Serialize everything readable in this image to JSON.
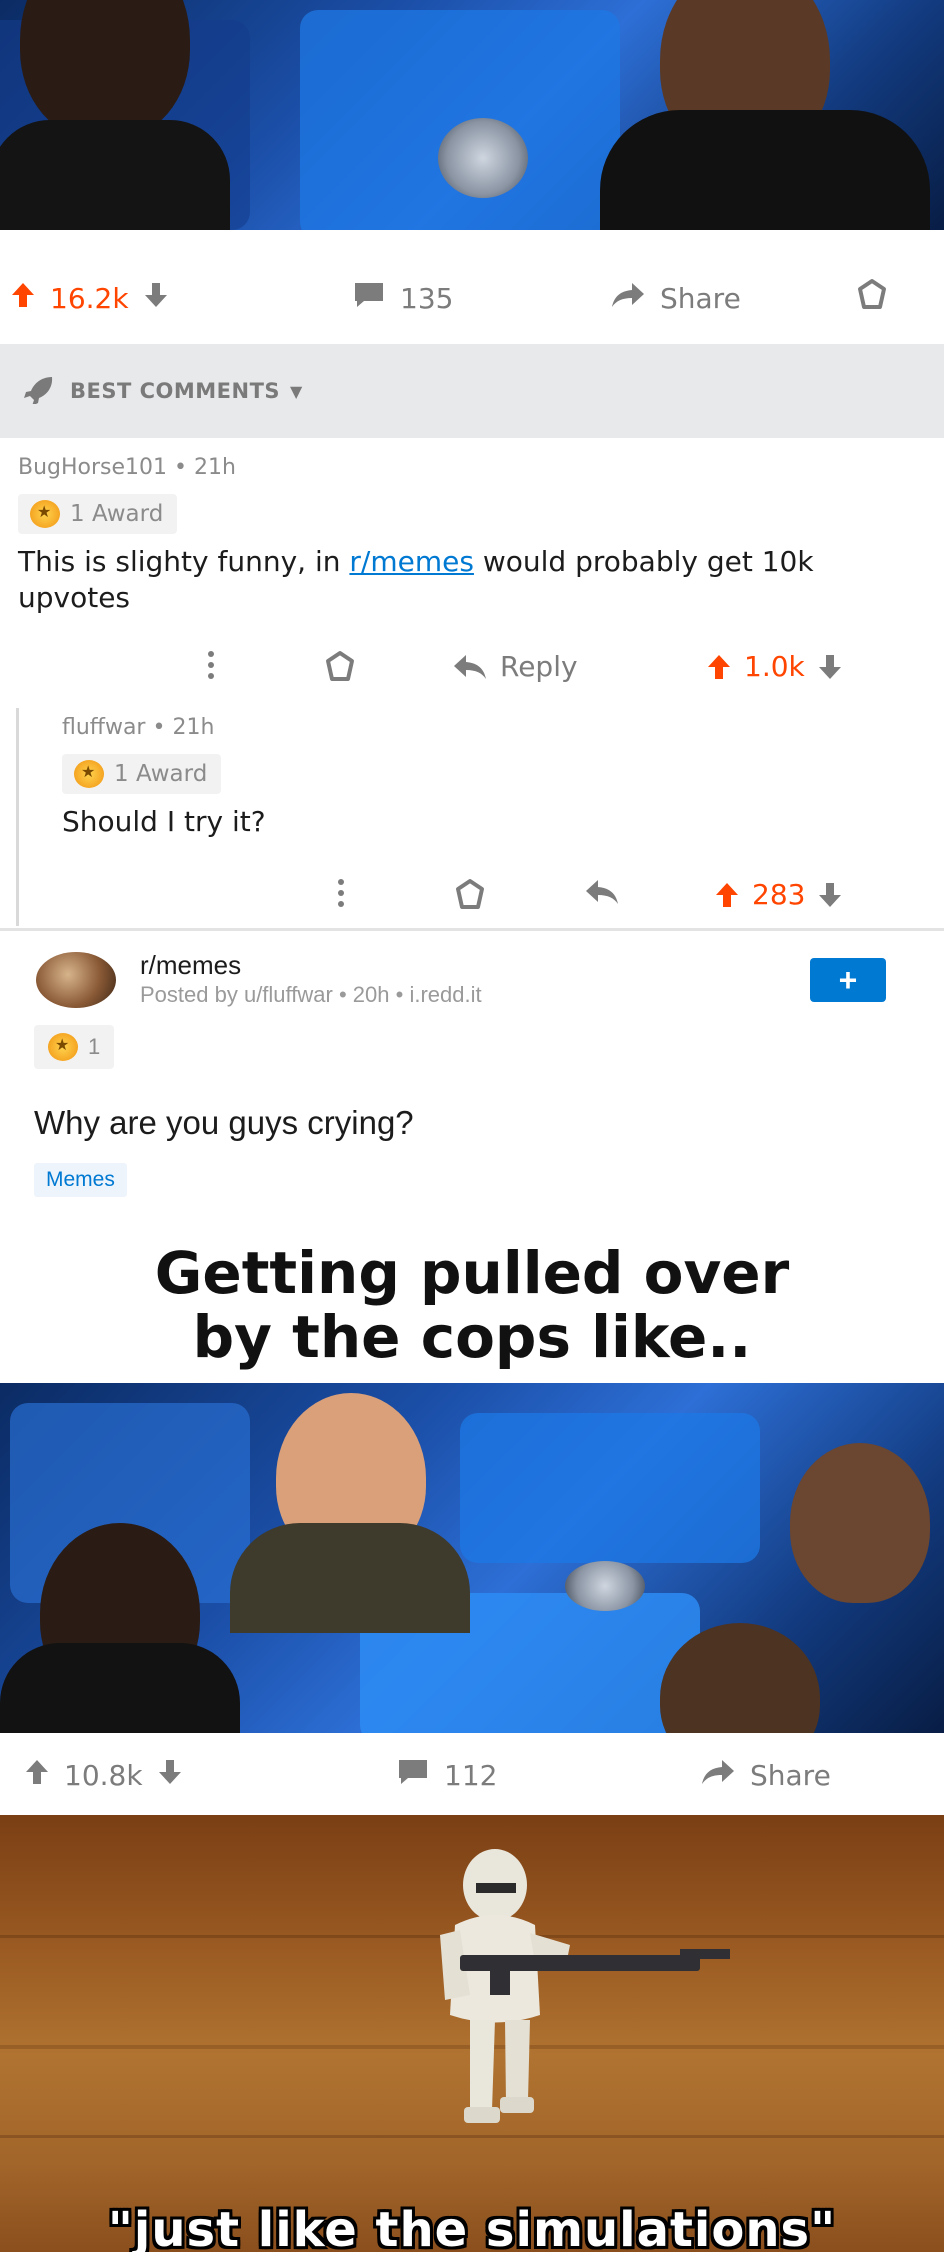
{
  "top_post": {
    "upvotes": "16.2k",
    "comments": "135",
    "share_label": "Share"
  },
  "best_comments": {
    "label": "BEST COMMENTS"
  },
  "comments": [
    {
      "author": "BugHorse101",
      "age": "21h",
      "award": "1 Award",
      "text_before": "This is slighty funny, in ",
      "link": "r/memes",
      "text_after": " would probably get 10k upvotes",
      "reply_label": "Reply",
      "votes": "1.0k"
    },
    {
      "author": "fluffwar",
      "age": "21h",
      "award": "1 Award",
      "text": "Should I try it?",
      "votes": "283"
    }
  ],
  "post": {
    "subreddit": "r/memes",
    "posted_by": "Posted by u/fluffwar",
    "age": "20h",
    "domain": "i.redd.it",
    "join_label": "+",
    "award_count": "1",
    "title": "Why are you guys crying?",
    "flair": "Memes",
    "meme_caption_line1": "Getting pulled over",
    "meme_caption_line2": "by the cops like..",
    "upvotes": "10.8k",
    "comments": "112",
    "share_label": "Share"
  },
  "bottom_meme": {
    "caption": "\"just like the simulations\""
  },
  "colors": {
    "upvote": "#ff4500",
    "link": "#0079d3",
    "join_button": "#0079d3"
  }
}
